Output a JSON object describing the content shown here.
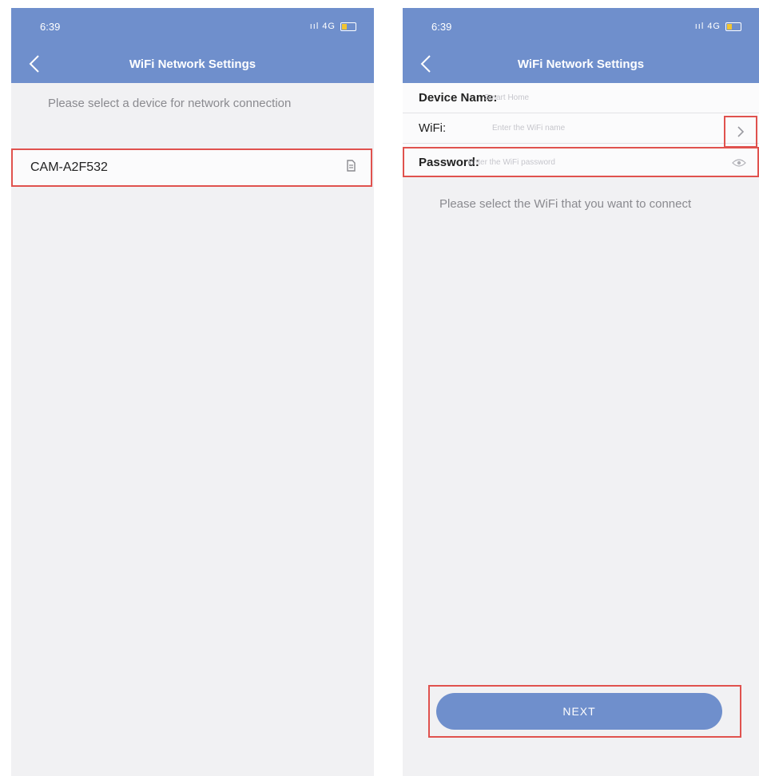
{
  "left_screen": {
    "status": {
      "time": "6:39",
      "signal": "ııl 4G"
    },
    "title": "WiFi Network Settings",
    "hint": "Please select a device for network connection",
    "devices": [
      {
        "name": "CAM-A2F532",
        "icon": "file-icon"
      }
    ]
  },
  "right_screen": {
    "status": {
      "time": "6:39",
      "signal": "ııl 4G"
    },
    "title": "WiFi Network Settings",
    "form": {
      "device_name_label": "Device Name:",
      "device_name_placeholder": "Smart Home",
      "wifi_label": "WiFi:",
      "wifi_placeholder": "Enter the WiFi name",
      "password_label": "Password:",
      "password_placeholder": "Enter the WiFi password"
    },
    "hint": "Please select the WiFi that you want to connect",
    "next_label": "NEXT"
  },
  "colors": {
    "header": "#6f8fcc",
    "highlight": "#e0524e",
    "background": "#f1f1f3",
    "battery": "#f2c531"
  }
}
